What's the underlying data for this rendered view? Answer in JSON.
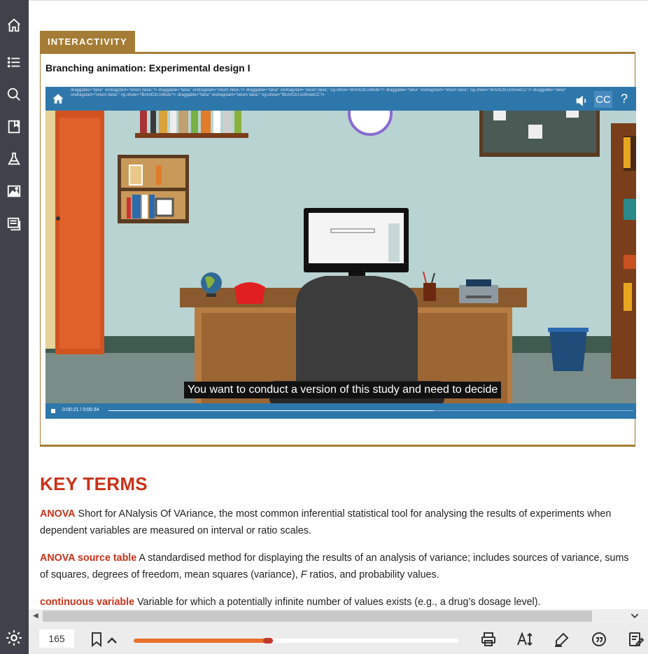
{
  "section_tag": "INTERACTIVITY",
  "interactive_title": "Branching animation: Experimental design I",
  "video": {
    "garbled_text": "draggable=\"false\" ondragstart=\"return false;\"/> draggable=\"false\" ondragstart=\"return false;\"/> draggable=\"false\" ondragstart=\"return false;\" ng-show=\"BrArtCtrl.isMute\"/> draggable=\"false\" ondragstart=\"return false;\" ng-show=\"BrArtCtrl.isShowCC\"/> draggable=\"false\" ondragstart=\"return false;\" ng-show=\"!BrArtCtrl.isMute\"/> draggable=\"false\" ondragstart=\"return false;\" ng-show=\"!BrArtCtrl.isShowCC\"/>",
    "cc_label": "CC",
    "help_label": "?",
    "caption": "You want to conduct a version of this study and need to decide",
    "time": "0:00:21 / 0:00:34",
    "progress": 0.62
  },
  "key_terms": {
    "heading": "KEY TERMS",
    "items": [
      {
        "term": "ANOVA",
        "definition": " Short for ANalysis Of VAriance, the most common inferential statistical tool for analysing the results of experiments when dependent variables are measured on interval or ratio scales."
      },
      {
        "term": "ANOVA source table",
        "definition_a": " A standardised method for displaying the results of an analysis of variance; includes sources of variance, sums of squares, degrees of freedom, mean squares (variance), ",
        "italic": "F",
        "definition_b": " ratios, and probability values."
      },
      {
        "term": "continuous variable",
        "definition": " Variable for which a potentially infinite number of values exists (e.g., a drug’s dosage level)."
      }
    ]
  },
  "footer": {
    "page_number": "165",
    "reading_progress": 0.42
  },
  "icons": {
    "sidebar": [
      "home-icon",
      "contents-list-icon",
      "search-icon",
      "bookmark-page-icon",
      "flask-icon",
      "image-gallery-icon",
      "notes-icon"
    ],
    "bottom": [
      "bookmark-icon",
      "chevron-up-icon",
      "print-icon",
      "text-size-icon",
      "highlighter-icon",
      "quote-icon",
      "notes-edit-icon",
      "gear-icon"
    ]
  }
}
